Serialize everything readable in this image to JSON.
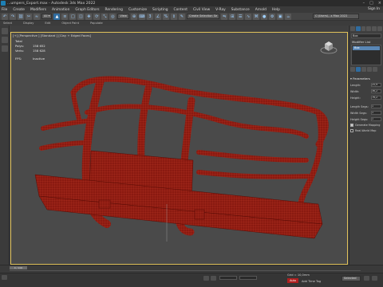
{
  "window": {
    "title": "...umpers_Export.max - Autodesk 3ds Max 2022",
    "controls": [
      "–",
      "□",
      "×"
    ]
  },
  "menu": {
    "items": [
      "File",
      "Create",
      "Modifiers",
      "Animation",
      "Graph Editors",
      "Rendering",
      "Customize",
      "Scripting",
      "Content",
      "Civil View",
      "V-Ray",
      "Substance",
      "Arnold",
      "Help"
    ],
    "sign_in": "Sign In"
  },
  "toolbar": {
    "view_dropdown": "View",
    "selection_set": "Create Selection Se",
    "workspace": "C:\\Users\\...s Max 2022"
  },
  "ribbon": {
    "tabs": [
      "Select",
      "Display",
      "Edit",
      "Object Paint",
      "Populate"
    ]
  },
  "viewport": {
    "label": "[+] [Perspective ] [Standard ] [Clay + Edged Faces]",
    "stats": {
      "total_label": "Total",
      "polys_label": "Polys:",
      "polys_value": "158 652",
      "verts_label": "Verts:",
      "verts_value": "158 628",
      "fps_label": "FPS:",
      "fps_value": "Inactive"
    },
    "model_color": "#8a1a10",
    "wire_color": "#c23a28"
  },
  "command_panel": {
    "object_name": "Box",
    "modifier_list_label": "Modifier List",
    "stack_items": [
      "Box"
    ],
    "rollout_title": "Parameters",
    "params": [
      {
        "label": "Length:",
        "value": "25,9"
      },
      {
        "label": "Width:",
        "value": "36,2"
      },
      {
        "label": "Height:",
        "value": "76,2"
      },
      {
        "label": "Length Segs:",
        "value": "1"
      },
      {
        "label": "Width Segs:",
        "value": "1"
      },
      {
        "label": "Height Segs:",
        "value": "1"
      }
    ],
    "checkboxes": [
      {
        "label": "Generate Mapping",
        "checked": true
      },
      {
        "label": "Real-World Map",
        "checked": false
      }
    ]
  },
  "timeline": {
    "slider_text": "0 / 100"
  },
  "status": {
    "coord_x": "",
    "coord_y": "",
    "grid_label": "Grid = 10,0mm",
    "add_time_tag": "Add Time Tag",
    "selected_dropdown": "Selected",
    "autokey": "Auto"
  }
}
